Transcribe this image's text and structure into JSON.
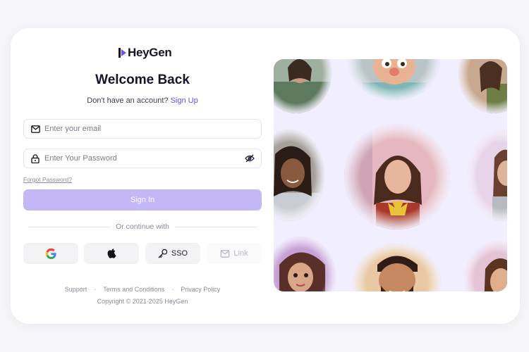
{
  "brand": {
    "name": "HeyGen",
    "accent": "#6b4df0",
    "button_color": "#c3b7f8"
  },
  "header": {
    "title": "Welcome Back",
    "signup_prompt": "Don't have an account?",
    "signup_link": "Sign Up"
  },
  "form": {
    "email": {
      "placeholder": "Enter your email",
      "value": "",
      "icon": "mail-icon"
    },
    "password": {
      "placeholder": "Enter Your Password",
      "value": "",
      "icon": "lock-icon",
      "toggle_icon": "eye-off-icon"
    },
    "forgot_label": "Forgot Password?",
    "submit_label": "Sign In"
  },
  "divider_text": "Or continue with",
  "social": [
    {
      "id": "google",
      "label": "",
      "icon": "google-icon"
    },
    {
      "id": "apple",
      "label": "",
      "icon": "apple-icon"
    },
    {
      "id": "sso",
      "label": "SSO",
      "icon": "key-icon"
    },
    {
      "id": "link",
      "label": "Link",
      "icon": "mail-icon",
      "disabled": true
    }
  ],
  "footer": {
    "links": [
      "Support",
      "Terms and Conditions",
      "Privacy Policy"
    ],
    "separator": "·",
    "copyright": "Copyright © 2021-2025 HeyGen"
  }
}
